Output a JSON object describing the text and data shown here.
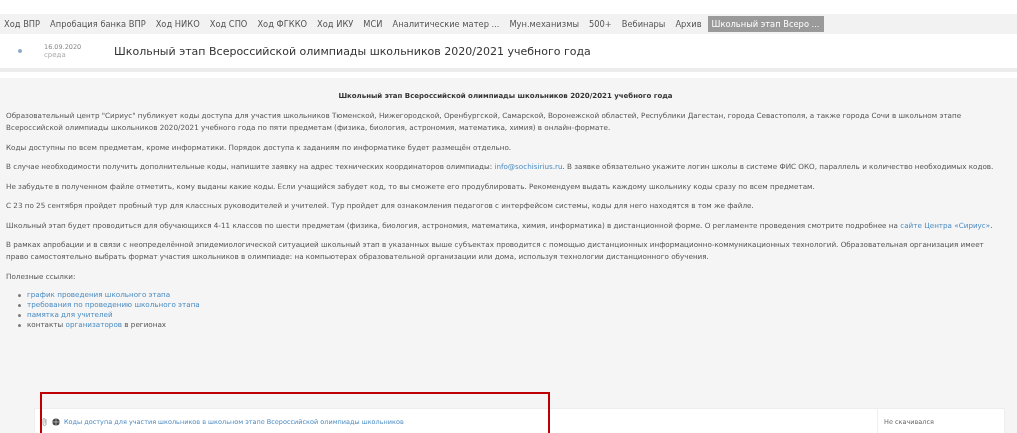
{
  "tabs": [
    {
      "label": "Ход ВПР",
      "selected": false
    },
    {
      "label": "Апробация банка ВПР",
      "selected": false
    },
    {
      "label": "Ход НИКО",
      "selected": false
    },
    {
      "label": "Ход СПО",
      "selected": false
    },
    {
      "label": "Ход ФГККО",
      "selected": false
    },
    {
      "label": "Ход ИКУ",
      "selected": false
    },
    {
      "label": "МСИ",
      "selected": false
    },
    {
      "label": "Аналитические матер ...",
      "selected": false
    },
    {
      "label": "Мун.механизмы",
      "selected": false
    },
    {
      "label": "500+",
      "selected": false
    },
    {
      "label": "Вебинары",
      "selected": false
    },
    {
      "label": "Архив",
      "selected": false
    },
    {
      "label": "Школьный этап Всеро ...",
      "selected": true
    }
  ],
  "post": {
    "date": "16.09.2020",
    "weekday": "среда",
    "title": "Школьный этап Всероссийской олимпиады школьников 2020/2021 учебного года"
  },
  "article": {
    "heading": "Школьный этап Всероссийской олимпиады школьников 2020/2021 учебного года",
    "paragraphs": [
      [
        {
          "text": "Образовательный центр \"Сириус\" публикует коды доступа для участия школьников Тюменской, Нижегородской, Оренбургской, Самарской, Воронежской областей, Республики Дагестан, города Севастополя, а также города Сочи в школьном этапе Всероссийской олимпиады школьников 2020/2021 учебного года по пяти предметам (физика, биология, астрономия, математика, химия) в онлайн-формате."
        }
      ],
      [
        {
          "text": "Коды доступны по всем предметам, кроме информатики. Порядок доступа к заданиям по информатике будет размещён отдельно."
        }
      ],
      [
        {
          "text": "В случае необходимости получить дополнительные коды, напишите заявку на адрес технических координаторов олимпиады: "
        },
        {
          "text": "info@sochisirius.ru",
          "link": true
        },
        {
          "text": ". В заявке обязательно укажите логин школы в системе ФИС ОКО, параллель и количество необходимых кодов."
        }
      ],
      [
        {
          "text": "Не забудьте в полученном файле отметить, кому выданы какие коды. Если учащийся забудет код, то вы сможете его продублировать. Рекомендуем выдать каждому школьнику коды сразу по всем предметам."
        }
      ],
      [
        {
          "text": "С 23 по 25 сентября пройдет пробный тур для классных руководителей и учителей. Тур пройдет для ознакомления педагогов с интерфейсом системы, коды для него находятся в том же файле."
        }
      ],
      [
        {
          "text": "Школьный этап будет проводиться для обучающихся 4-11 классов по шести предметам (физика, биология, астрономия, математика, химия, информатика) в дистанционной форме. О регламенте проведения смотрите подробнее на "
        },
        {
          "text": "сайте Центра «Сириус»",
          "link": true
        },
        {
          "text": "."
        }
      ],
      [
        {
          "text": "В рамках апробации и в связи с неопределённой эпидемиологической ситуацией школьный этап в указанных выше субъектах проводится с помощью дистанционных информационно-коммуникационных технологий. Образовательная организация имеет право самостоятельно выбрать формат участия школьников в олимпиаде: на компьютерах образовательной организации или дома, используя технологии дистанционного обучения."
        }
      ],
      [
        {
          "text": "Полезные ссылки:"
        }
      ]
    ],
    "links": [
      [
        {
          "text": "график проведения школьного этапа",
          "link": true
        }
      ],
      [
        {
          "text": "требования по проведению школьного этапа",
          "link": true
        }
      ],
      [
        {
          "text": "памятка для учителей",
          "link": true
        }
      ],
      [
        {
          "text": "контакты ",
          "link": false
        },
        {
          "text": "организаторов",
          "link": true
        },
        {
          "text": " в регионах",
          "link": false
        }
      ]
    ]
  },
  "file": {
    "name": "Коды доступа для участия школьников в школьном этапе Всероссийской олимпиады школьников",
    "status": "Не скачивался"
  }
}
